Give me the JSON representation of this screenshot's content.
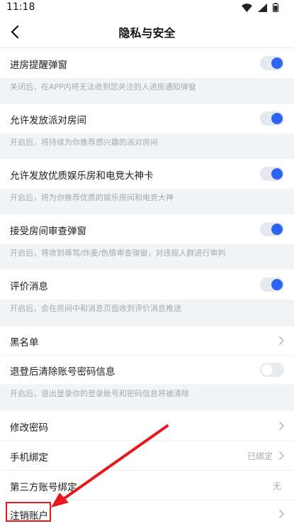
{
  "status_bar": {
    "time": "11:18"
  },
  "nav": {
    "title": "隐私与安全"
  },
  "settings": {
    "room_entry_popup": {
      "label": "进房提醒弹窗",
      "desc": "关闭后，在APP内将无法收到您关注的人进房通知弹窗",
      "enabled": true
    },
    "party_rooms": {
      "label": "允许发放派对房间",
      "desc": "开启后，将持续为你推荐感兴趣的派对房间",
      "enabled": true
    },
    "entertainment_rooms": {
      "label": "允许发放优质娱乐房和电竞大神卡",
      "desc": "开启后，将为你推荐优质的娱乐房间和电竞大神",
      "enabled": true
    },
    "review_popup": {
      "label": "接受房间审查弹窗",
      "desc": "开启后，将收到辱骂/炸麦/色情审查弹窗，对违规人群进行审判",
      "enabled": true
    },
    "rating_message": {
      "label": "评价消息",
      "desc": "开启后，会在房间中和消息页面收到评价消息推送",
      "enabled": true
    },
    "blacklist": {
      "label": "黑名单"
    },
    "clear_credentials": {
      "label": "退登后清除账号密码信息",
      "desc": "开启后，退出登录你的登录账号和密码信息将被清除",
      "enabled": false
    },
    "change_password": {
      "label": "修改密码"
    },
    "phone_binding": {
      "label": "手机绑定",
      "value": "已绑定"
    },
    "third_party_binding": {
      "label": "第三方账号绑定",
      "value": "无"
    },
    "cancel_account": {
      "label": "注销账户"
    }
  },
  "annotation": {
    "color": "#e8171c"
  },
  "colors": {
    "accent": "#2c64f5",
    "background": "#f3f4f6",
    "desc_text": "#a5a8ad"
  },
  "icons": [
    "back-arrow-icon",
    "wifi-icon",
    "signal-icon",
    "battery-icon",
    "chevron-right-icon"
  ]
}
